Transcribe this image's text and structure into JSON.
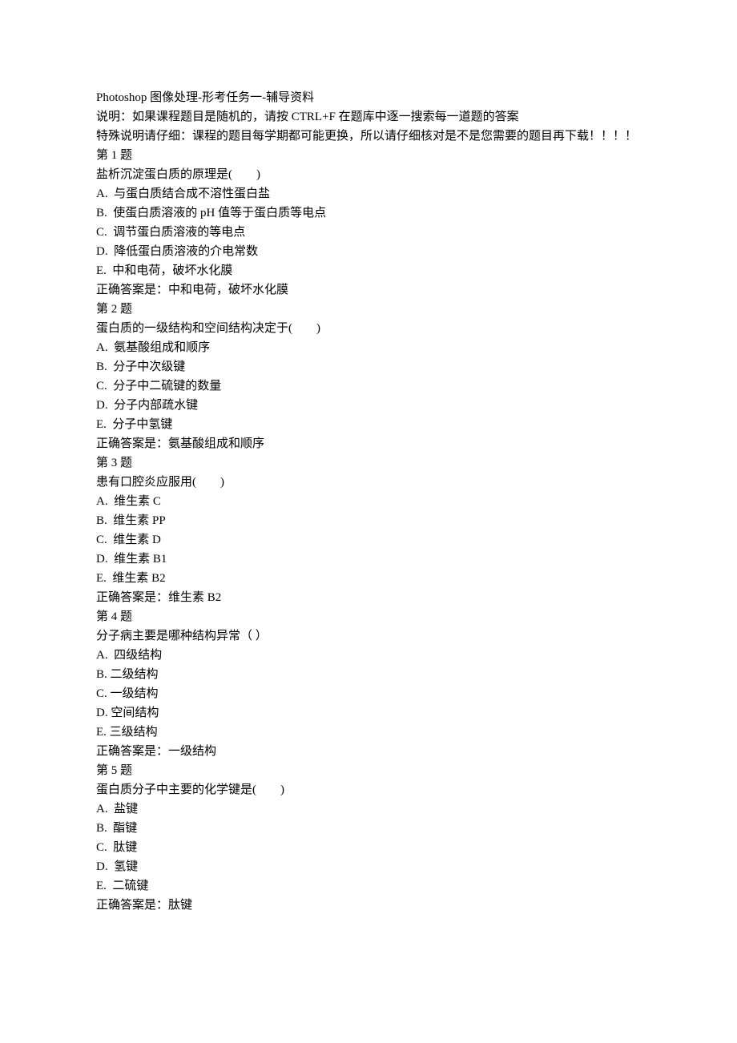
{
  "title": "Photoshop 图像处理-形考任务一-辅导资料",
  "instruction1": "说明：如果课程题目是随机的，请按 CTRL+F 在题库中逐一搜索每一道题的答案",
  "instruction2": "特殊说明请仔细：课程的题目每学期都可能更换，所以请仔细核对是不是您需要的题目再下载！！！！",
  "questions": [
    {
      "heading": "第 1 题",
      "stem": "盐析沉淀蛋白质的原理是(　　)",
      "options": [
        "A.  与蛋白质结合成不溶性蛋白盐",
        "B.  使蛋白质溶液的 pH 值等于蛋白质等电点",
        "C.  调节蛋白质溶液的等电点",
        "D.  降低蛋白质溶液的介电常数",
        "E.  中和电荷，破坏水化膜"
      ],
      "answer": "正确答案是：中和电荷，破坏水化膜"
    },
    {
      "heading": "第 2 题",
      "stem": "蛋白质的一级结构和空间结构决定于(　　)",
      "options": [
        "A.  氨基酸组成和顺序",
        "B.  分子中次级键",
        "C.  分子中二硫键的数量",
        "D.  分子内部疏水键",
        "E.  分子中氢键"
      ],
      "answer": "正确答案是：氨基酸组成和顺序"
    },
    {
      "heading": "第 3 题",
      "stem": "患有口腔炎应服用(　　)",
      "options": [
        "A.  维生素 C",
        "B.  维生素 PP",
        "C.  维生素 D",
        "D.  维生素 B1",
        "E.  维生素 B2"
      ],
      "answer": "正确答案是：维生素 B2"
    },
    {
      "heading": "第 4 题",
      "stem": "分子病主要是哪种结构异常（ ）",
      "options": [
        "A.  四级结构",
        "B. 二级结构",
        "C. 一级结构",
        "D. 空间结构",
        "E. 三级结构"
      ],
      "answer": "正确答案是：一级结构"
    },
    {
      "heading": "第 5 题",
      "stem": "蛋白质分子中主要的化学键是(　　)",
      "options": [
        "A.  盐键",
        "B.  酯键",
        "C.  肽键",
        "D.  氢键",
        "E.  二硫键"
      ],
      "answer": "正确答案是：肽键"
    }
  ]
}
